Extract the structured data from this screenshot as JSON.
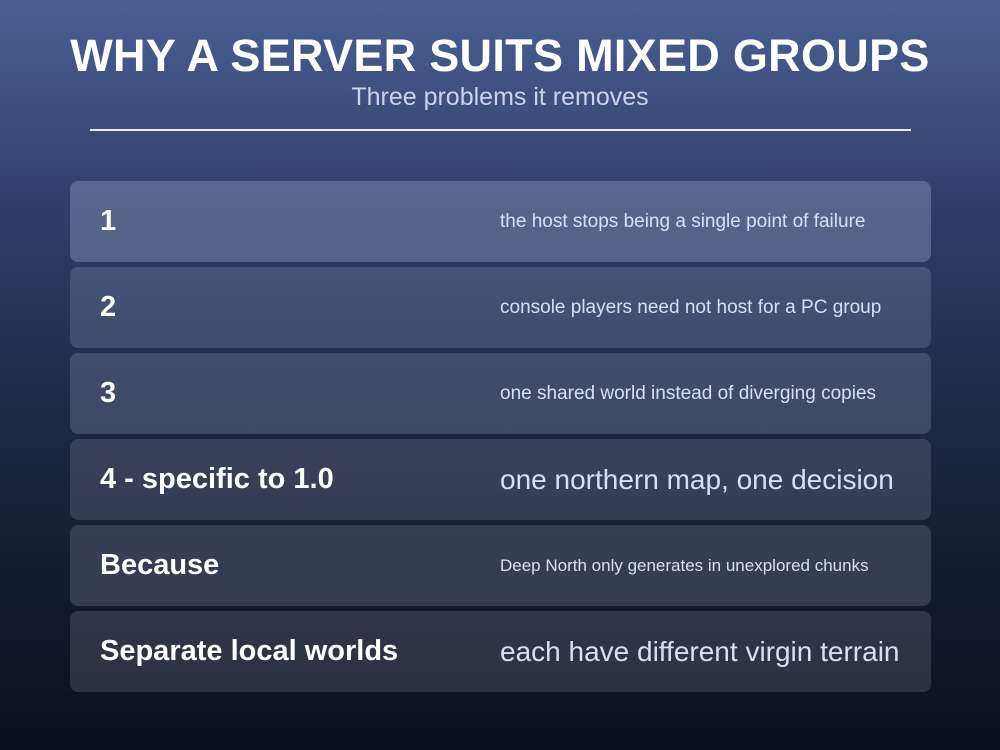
{
  "title": "WHY A SERVER SUITS MIXED GROUPS",
  "subtitle": "Three problems it removes",
  "rows": [
    {
      "label": "1",
      "description": "the host stops being a single point of failure"
    },
    {
      "label": "2",
      "description": "console players need not host for a PC group"
    },
    {
      "label": "3",
      "description": "one shared world instead of diverging copies"
    },
    {
      "label": "4 - specific to 1.0",
      "description": "one northern map, one decision"
    },
    {
      "label": "Because",
      "description": "Deep North only generates in unexplored chunks"
    },
    {
      "label": "Separate local worlds",
      "description": "each have different virgin terrain"
    }
  ],
  "colors": {
    "background_top": "#4a5f94",
    "background_bottom": "#0b0f1c",
    "title_text": "#ffffff",
    "subtitle_text": "#c9d3ea",
    "description_text": "#d3e0f5"
  }
}
